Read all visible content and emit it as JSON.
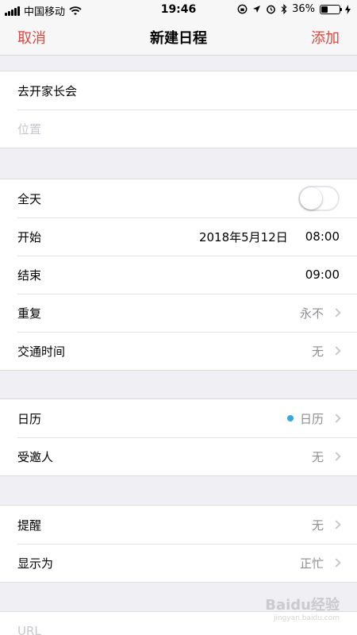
{
  "status_bar": {
    "carrier": "中国移动",
    "time": "19:46",
    "battery_text": "36%",
    "battery_level": 0.36,
    "icons": [
      "signal-icon",
      "wifi-icon",
      "lock-rotation-icon",
      "location-icon",
      "alarm-icon",
      "bluetooth-icon",
      "battery-icon",
      "charging-icon"
    ]
  },
  "nav": {
    "cancel_label": "取消",
    "title": "新建日程",
    "add_label": "添加"
  },
  "event": {
    "title_value": "去开家长会",
    "location_placeholder": "位置"
  },
  "time_section": {
    "all_day_label": "全天",
    "all_day_on": false,
    "start_label": "开始",
    "start_date": "2018年5月12日",
    "start_time": "08:00",
    "end_label": "结束",
    "end_time": "09:00",
    "repeat_label": "重复",
    "repeat_value": "永不",
    "travel_label": "交通时间",
    "travel_value": "无"
  },
  "calendar_section": {
    "calendar_label": "日历",
    "calendar_value": "日历",
    "calendar_color": "#35a9e1",
    "invitees_label": "受邀人",
    "invitees_value": "无"
  },
  "alert_section": {
    "alert_label": "提醒",
    "alert_value": "无",
    "show_as_label": "显示为",
    "show_as_value": "正忙"
  },
  "extra_section": {
    "url_placeholder": "URL"
  },
  "watermark": {
    "text": "Baidu经验",
    "sub": "jingyan.baidu.com"
  },
  "colors": {
    "accent": "#e0463e",
    "background": "#efeff4"
  }
}
